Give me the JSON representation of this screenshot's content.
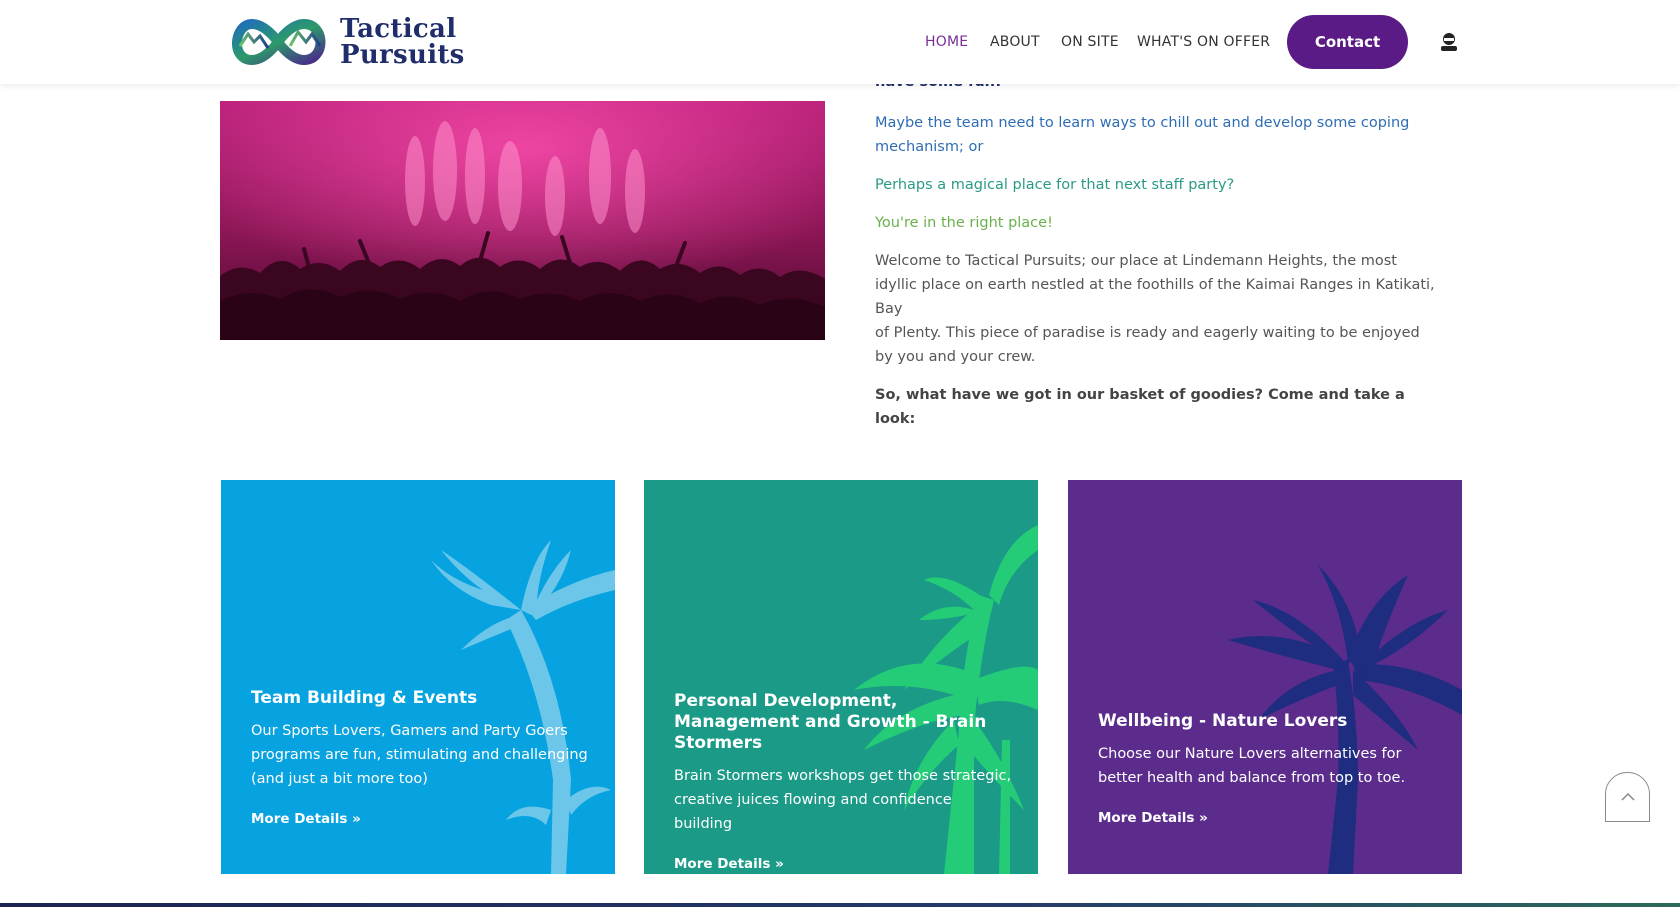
{
  "header": {
    "logo_text_line1": "Tactical",
    "logo_text_line2": "Pursuits",
    "nav": [
      {
        "label": "HOME"
      },
      {
        "label": "ABOUT"
      },
      {
        "label": "ON SITE"
      },
      {
        "label": "WHAT'S ON OFFER"
      }
    ],
    "contact_label": "Contact",
    "colors": {
      "active_nav": "#7a2f98",
      "contact_bg": "#5a1b86"
    }
  },
  "intro": {
    "cut_line": "have some fun!",
    "p1": "Maybe the team need to learn ways to chill out and develop some coping mechanism; or",
    "p2": "Perhaps a magical place for that next staff party?",
    "p3": "You're in the right place!",
    "p4_lines": [
      "Welcome to Tactical Pursuits; our place at Lindemann Heights, the most",
      "idyllic place on earth nestled at the foothills of the Kaimai Ranges in Katikati, Bay",
      "of Plenty. This piece of paradise is ready and eagerly waiting to be enjoyed",
      "by you and your crew."
    ],
    "p5": "So, what have we got in our basket of goodies? Come and take a look:"
  },
  "cards": [
    {
      "title": "Team Building & Events",
      "desc": "Our Sports Lovers, Gamers and Party Goers programs are fun, stimulating and challenging (and just a bit more too)",
      "link": "More Details »",
      "bg": "#06a3e0"
    },
    {
      "title": "Personal Development, Management and Growth - Brain Stormers",
      "desc": "Brain Stormers workshops get those strategic, creative juices flowing and confidence building",
      "link": "More Details »",
      "bg": "#1a9a87"
    },
    {
      "title": "Wellbeing - Nature Lovers",
      "desc": "Choose our Nature Lovers alternatives for better health and balance from top to toe.",
      "link": "More Details »",
      "bg": "#5b2c8b"
    }
  ]
}
